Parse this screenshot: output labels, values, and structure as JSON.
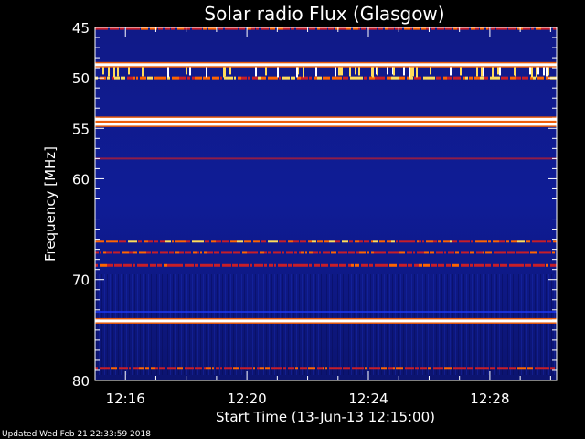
{
  "chart_data": {
    "type": "heatmap",
    "title": "Solar radio Flux (Glasgow)",
    "xlabel": "Start Time (13-Jun-13 12:15:00)",
    "ylabel": "Frequency [MHz]",
    "x_unit": "minutes after 12:15:00",
    "xlim": [
      0,
      15.2
    ],
    "ylim": [
      80,
      45
    ],
    "x_ticks": [
      {
        "value": 1,
        "label": "12:16"
      },
      {
        "value": 5,
        "label": "12:20"
      },
      {
        "value": 9,
        "label": "12:24"
      },
      {
        "value": 13,
        "label": "12:28"
      }
    ],
    "y_ticks": [
      {
        "value": 45,
        "label": "45"
      },
      {
        "value": 50,
        "label": "50"
      },
      {
        "value": 55,
        "label": "55"
      },
      {
        "value": 60,
        "label": "60"
      },
      {
        "value": 70,
        "label": "70"
      },
      {
        "value": 80,
        "label": "80"
      }
    ],
    "emission_bands": [
      {
        "freq": 45.1,
        "intensity": 0.55
      },
      {
        "freq": 48.7,
        "intensity": 0.95
      },
      {
        "freq": 50.0,
        "intensity": 0.8
      },
      {
        "freq": 54.1,
        "intensity": 0.95
      },
      {
        "freq": 54.6,
        "intensity": 1.0
      },
      {
        "freq": 58.0,
        "intensity": 0.35
      },
      {
        "freq": 66.2,
        "intensity": 0.75
      },
      {
        "freq": 67.3,
        "intensity": 0.55
      },
      {
        "freq": 68.6,
        "intensity": 0.5
      },
      {
        "freq": 73.2,
        "intensity": 0.3
      },
      {
        "freq": 74.1,
        "intensity": 0.95
      },
      {
        "freq": 78.8,
        "intensity": 0.55
      }
    ],
    "colormap": [
      "#000033",
      "#0a1ea0",
      "#1e3cff",
      "#c81e28",
      "#ff6400",
      "#ffdc5a",
      "#ffffff"
    ]
  },
  "footer": {
    "updated": "Updated Wed Feb 21 22:33:59 2018"
  }
}
